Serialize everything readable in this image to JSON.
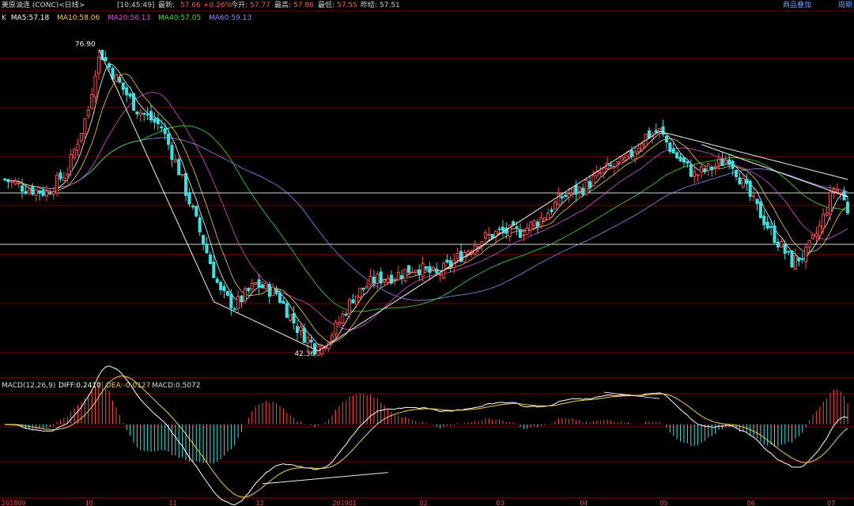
{
  "header": {
    "title": "美原油连 (CONC)<日线>",
    "time": "[10:45:49]",
    "latest_label": "最新:",
    "latest_value": "57.66",
    "change": "+0.26%",
    "open_label": "今开:",
    "open_value": "57.77",
    "high_label": "最高:",
    "high_value": "57.86",
    "low_label": "最低:",
    "low_value": "57.55",
    "prev_label": "昨结:",
    "prev_value": "57.51",
    "add_product": "商品叠加",
    "period": "周期"
  },
  "ma_legend": [
    {
      "label": "K",
      "color": "#dddddd"
    },
    {
      "label": "MA5:57.18",
      "color": "#ffffff"
    },
    {
      "label": "MA10:58.06",
      "color": "#f2d150"
    },
    {
      "label": "MA20:56.13",
      "color": "#e050e0"
    },
    {
      "label": "MA40:57.05",
      "color": "#40e040"
    },
    {
      "label": "MA60:59.13",
      "color": "#8c8cff"
    }
  ],
  "macd_legend": {
    "label": "MACD(12,26,9)",
    "diff": "DIFF:0.2410",
    "dea": "DEA:-0.0127",
    "macd": "MACD:0.5072"
  },
  "colors": {
    "up": "#ff4b4b",
    "down": "#40e0e0",
    "grid": "#7a0000",
    "ma5": "#ffffff",
    "ma10": "#f2d150",
    "ma20": "#e050e0",
    "ma40": "#40e040",
    "ma60": "#8c8cff",
    "diff": "#ffffff",
    "dea": "#f2d150"
  },
  "chart_data": {
    "type": "candlestick",
    "price_ylim": [
      40,
      80
    ],
    "price_annotations": [
      {
        "text": "76.90",
        "value": 76.9,
        "day": 27
      },
      {
        "text": "42.36",
        "value": 42.36,
        "day": 90
      }
    ],
    "x_ticks": [
      {
        "label": "201809",
        "day": 0
      },
      {
        "label": "10",
        "day": 24
      },
      {
        "label": "11",
        "day": 48
      },
      {
        "label": "12",
        "day": 73
      },
      {
        "label": "201901",
        "day": 95
      },
      {
        "label": "02",
        "day": 120
      },
      {
        "label": "03",
        "day": 142
      },
      {
        "label": "04",
        "day": 166
      },
      {
        "label": "05",
        "day": 189
      },
      {
        "label": "06",
        "day": 214
      },
      {
        "label": "07",
        "day": 237
      }
    ],
    "total_days": 243,
    "macd_ylim": [
      -4.2,
      2.2
    ]
  }
}
